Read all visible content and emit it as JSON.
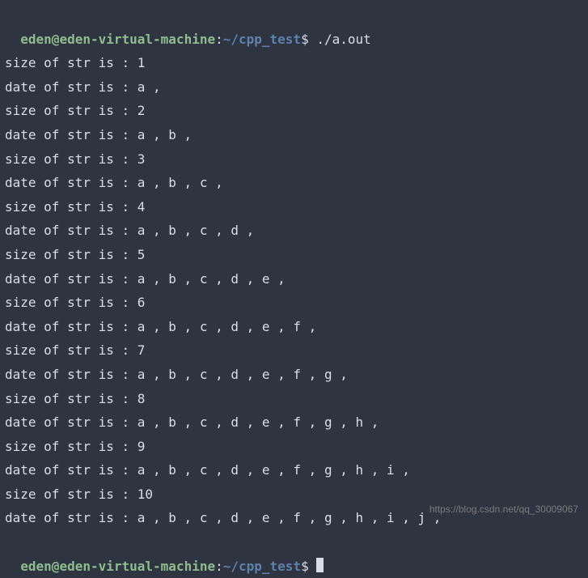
{
  "prompt1": {
    "user": "eden",
    "at": "@",
    "host": "eden-virtual-machine",
    "colon": ":",
    "path": "~/cpp_test",
    "dollar": "$ ",
    "command": "./a.out"
  },
  "output_lines": [
    "size of str is : 1",
    "date of str is : a ,",
    "size of str is : 2",
    "date of str is : a , b ,",
    "size of str is : 3",
    "date of str is : a , b , c ,",
    "size of str is : 4",
    "date of str is : a , b , c , d ,",
    "size of str is : 5",
    "date of str is : a , b , c , d , e ,",
    "size of str is : 6",
    "date of str is : a , b , c , d , e , f ,",
    "size of str is : 7",
    "date of str is : a , b , c , d , e , f , g ,",
    "size of str is : 8",
    "date of str is : a , b , c , d , e , f , g , h ,",
    "size of str is : 9",
    "date of str is : a , b , c , d , e , f , g , h , i ,",
    "size of str is : 10",
    "date of str is : a , b , c , d , e , f , g , h , i , j ,"
  ],
  "prompt2": {
    "user": "eden",
    "at": "@",
    "host": "eden-virtual-machine",
    "colon": ":",
    "path": "~/cpp_test",
    "dollar": "$ "
  },
  "watermark": "https://blog.csdn.net/qq_30009067"
}
